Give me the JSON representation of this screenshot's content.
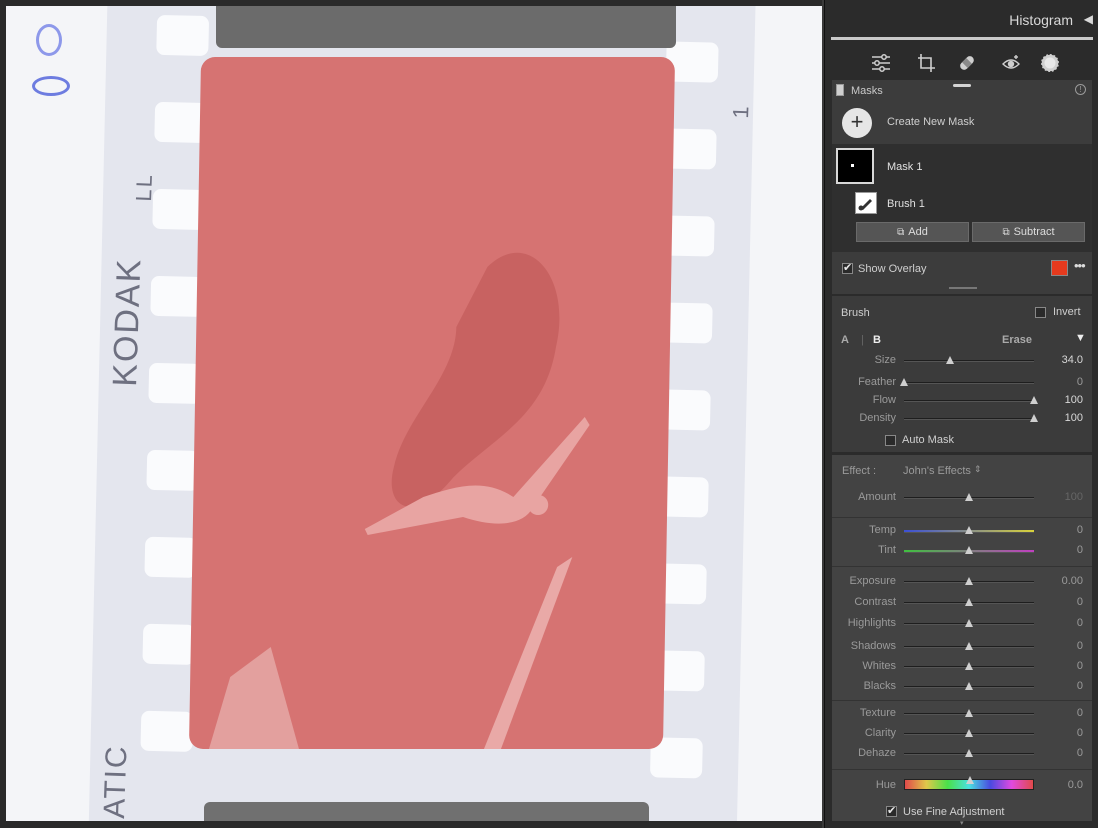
{
  "panel": {
    "histogram_label": "Histogram",
    "tools": [
      "sliders-icon",
      "crop-icon",
      "heal-icon",
      "redeye-icon",
      "masking-icon"
    ],
    "masks": {
      "title": "Masks",
      "create_label": "Create New Mask",
      "mask_name": "Mask 1",
      "component_name": "Brush 1",
      "add_label": "Add",
      "subtract_label": "Subtract",
      "show_overlay_label": "Show Overlay",
      "overlay_color": "#e53a1e"
    },
    "brush": {
      "title": "Brush",
      "invert_label": "Invert",
      "tab_a": "A",
      "tab_b": "B",
      "erase_label": "Erase",
      "size": {
        "label": "Size",
        "value": "34.0",
        "pos": 0.35
      },
      "feather": {
        "label": "Feather",
        "value": "0",
        "pos": 0.0
      },
      "flow": {
        "label": "Flow",
        "value": "100",
        "pos": 1.0
      },
      "density": {
        "label": "Density",
        "value": "100",
        "pos": 1.0
      },
      "auto_mask_label": "Auto Mask"
    },
    "effect": {
      "label": "Effect :",
      "preset": "John's Effects",
      "amount": {
        "label": "Amount",
        "value": "100",
        "pos": 0.5
      },
      "temp": {
        "label": "Temp",
        "value": "0",
        "pos": 0.5
      },
      "tint": {
        "label": "Tint",
        "value": "0",
        "pos": 0.5
      },
      "exposure": {
        "label": "Exposure",
        "value": "0.00",
        "pos": 0.5
      },
      "contrast": {
        "label": "Contrast",
        "value": "0",
        "pos": 0.5
      },
      "highlights": {
        "label": "Highlights",
        "value": "0",
        "pos": 0.5
      },
      "shadows": {
        "label": "Shadows",
        "value": "0",
        "pos": 0.5
      },
      "whites": {
        "label": "Whites",
        "value": "0",
        "pos": 0.5
      },
      "blacks": {
        "label": "Blacks",
        "value": "0",
        "pos": 0.5
      },
      "texture": {
        "label": "Texture",
        "value": "0",
        "pos": 0.5
      },
      "clarity": {
        "label": "Clarity",
        "value": "0",
        "pos": 0.5
      },
      "dehaze": {
        "label": "Dehaze",
        "value": "0",
        "pos": 0.5
      },
      "hue": {
        "label": "Hue",
        "value": "0.0",
        "pos": 0.5
      },
      "fine_adjust_label": "Use Fine Adjustment"
    }
  },
  "photo": {
    "edge_brand": "KODAK",
    "edge_marks": "LL",
    "edge_bottom": "ATIC",
    "frame_number": "1"
  }
}
